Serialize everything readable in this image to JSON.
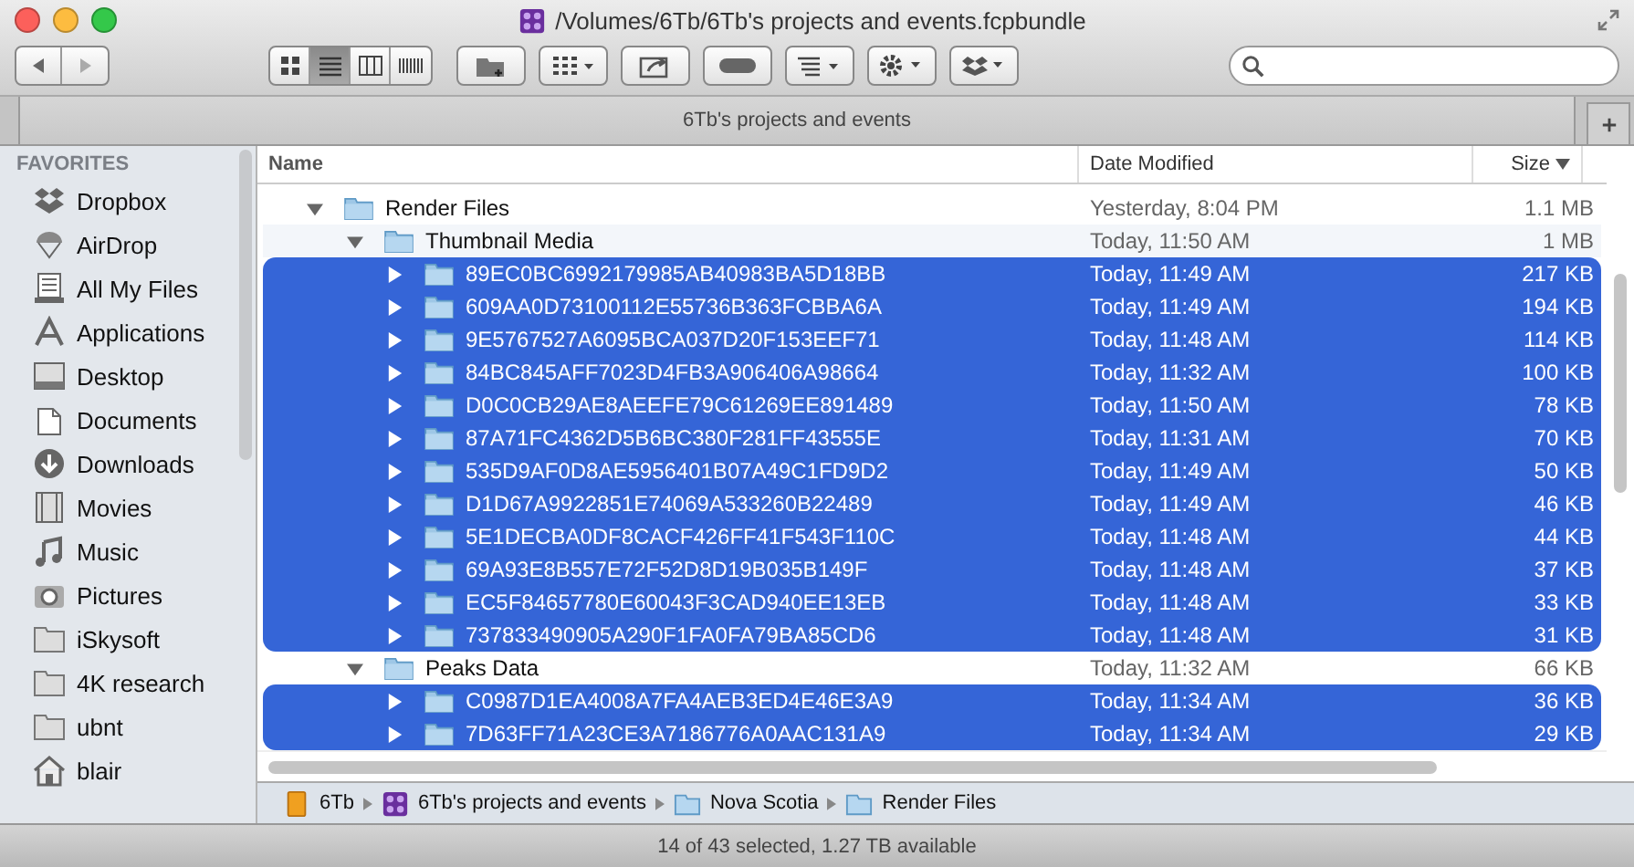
{
  "window": {
    "title": "/Volumes/6Tb/6Tb's projects and events.fcpbundle"
  },
  "toolbar": {
    "view_modes": [
      {
        "kind": "icons",
        "selected": false
      },
      {
        "kind": "list",
        "selected": true
      },
      {
        "kind": "columns",
        "selected": false
      },
      {
        "kind": "coverflow",
        "selected": false
      }
    ]
  },
  "tab": {
    "label": "6Tb's projects and events"
  },
  "sidebar": {
    "heading": "FAVORITES",
    "items": [
      {
        "label": "Dropbox",
        "kind": "dropbox"
      },
      {
        "label": "AirDrop",
        "kind": "airdrop"
      },
      {
        "label": "All My Files",
        "kind": "files"
      },
      {
        "label": "Applications",
        "kind": "apps"
      },
      {
        "label": "Desktop",
        "kind": "desktop"
      },
      {
        "label": "Documents",
        "kind": "documents"
      },
      {
        "label": "Downloads",
        "kind": "downloads"
      },
      {
        "label": "Movies",
        "kind": "movies"
      },
      {
        "label": "Music",
        "kind": "music"
      },
      {
        "label": "Pictures",
        "kind": "pictures"
      },
      {
        "label": "iSkysoft",
        "kind": "folder"
      },
      {
        "label": "4K research",
        "kind": "folder"
      },
      {
        "label": "ubnt",
        "kind": "folder"
      },
      {
        "label": "blair",
        "kind": "home"
      }
    ]
  },
  "table": {
    "columns": [
      {
        "label": "Name",
        "sorted": false
      },
      {
        "label": "Date Modified",
        "sorted": false
      },
      {
        "label": "Size",
        "sorted": true
      }
    ],
    "rows": [
      {
        "name": "Render Files",
        "date": "Yesterday, 8:04 PM",
        "size": "1.1 MB",
        "selected": false,
        "expanded": true,
        "children": [
          {
            "name": "Thumbnail Media",
            "date": "Today, 11:50 AM",
            "size": "1 MB",
            "selected": false,
            "expanded": true,
            "children": [
              {
                "name": "89EC0BC6992179985AB40983BA5D18BB",
                "date": "Today, 11:49 AM",
                "size": "217 KB",
                "selected": true,
                "expanded": false
              },
              {
                "name": "609AA0D73100112E55736B363FCBBA6A",
                "date": "Today, 11:49 AM",
                "size": "194 KB",
                "selected": true,
                "expanded": false
              },
              {
                "name": "9E5767527A6095BCA037D20F153EEF71",
                "date": "Today, 11:48 AM",
                "size": "114 KB",
                "selected": true,
                "expanded": false
              },
              {
                "name": "84BC845AFF7023D4FB3A906406A98664",
                "date": "Today, 11:32 AM",
                "size": "100 KB",
                "selected": true,
                "expanded": false
              },
              {
                "name": "D0C0CB29AE8AEEFE79C61269EE891489",
                "date": "Today, 11:50 AM",
                "size": "78 KB",
                "selected": true,
                "expanded": false
              },
              {
                "name": "87A71FC4362D5B6BC380F281FF43555E",
                "date": "Today, 11:31 AM",
                "size": "70 KB",
                "selected": true,
                "expanded": false
              },
              {
                "name": "535D9AF0D8AE5956401B07A49C1FD9D2",
                "date": "Today, 11:49 AM",
                "size": "50 KB",
                "selected": true,
                "expanded": false
              },
              {
                "name": "D1D67A9922851E74069A533260B22489",
                "date": "Today, 11:49 AM",
                "size": "46 KB",
                "selected": true,
                "expanded": false
              },
              {
                "name": "5E1DECBA0DF8CACF426FF41F543F110C",
                "date": "Today, 11:48 AM",
                "size": "44 KB",
                "selected": true,
                "expanded": false
              },
              {
                "name": "69A93E8B557E72F52D8D19B035B149F",
                "date": "Today, 11:48 AM",
                "size": "37 KB",
                "selected": true,
                "expanded": false
              },
              {
                "name": "EC5F84657780E60043F3CAD940EE13EB",
                "date": "Today, 11:48 AM",
                "size": "33 KB",
                "selected": true,
                "expanded": false
              },
              {
                "name": "737833490905A290F1FA0FA79BA85CD6",
                "date": "Today, 11:48 AM",
                "size": "31 KB",
                "selected": true,
                "expanded": false
              }
            ]
          },
          {
            "name": "Peaks Data",
            "date": "Today, 11:32 AM",
            "size": "66 KB",
            "selected": false,
            "expanded": true,
            "children": [
              {
                "name": "C0987D1EA4008A7FA4AEB3ED4E46E3A9",
                "date": "Today, 11:34 AM",
                "size": "36 KB",
                "selected": true,
                "expanded": false
              },
              {
                "name": "7D63FF71A23CE3A7186776A0AAC131A9",
                "date": "Today, 11:34 AM",
                "size": "29 KB",
                "selected": true,
                "expanded": false
              }
            ]
          }
        ]
      }
    ]
  },
  "path_bar": [
    {
      "label": "6Tb",
      "kind": "drive"
    },
    {
      "label": "6Tb's projects and events",
      "kind": "bundle"
    },
    {
      "label": "Nova Scotia",
      "kind": "folder"
    },
    {
      "label": "Render Files",
      "kind": "folder"
    }
  ],
  "status_bar": "14 of 43 selected, 1.27 TB available"
}
